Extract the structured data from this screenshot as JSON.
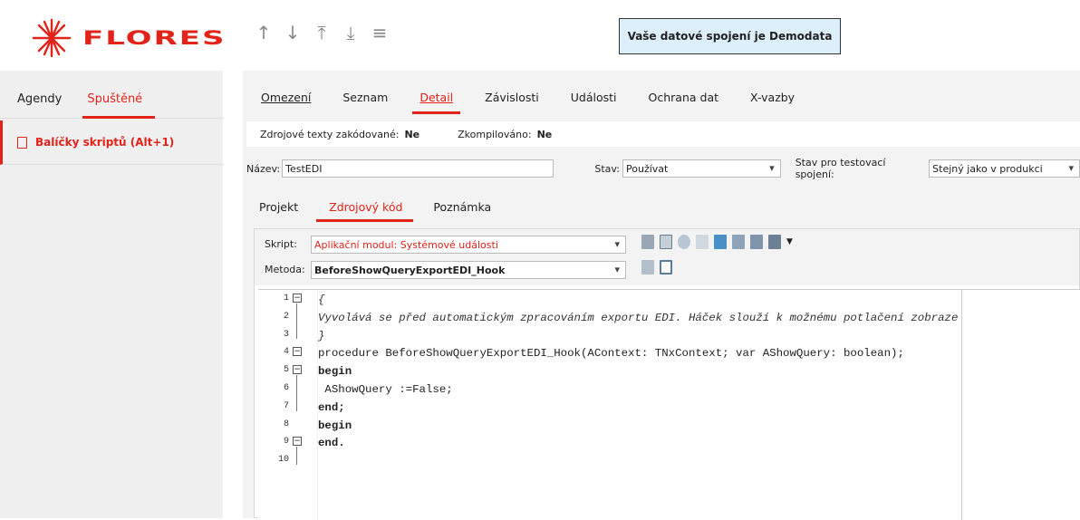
{
  "header": {
    "logo_text": "FLORES",
    "nav": [
      "↑",
      "↓",
      "⤒",
      "⤓",
      "≡"
    ],
    "connection_text": "Vaše datové spojení je Demodata",
    "brand_color": "#e2231a"
  },
  "left_panel": {
    "tabs": [
      {
        "label": "Agendy"
      },
      {
        "label": "Spuštěné"
      }
    ],
    "items": [
      {
        "label": "Balíčky skriptů (Alt+1)",
        "icon": "document-icon"
      }
    ]
  },
  "main_tabs": [
    {
      "label": "Omezení"
    },
    {
      "label": "Seznam"
    },
    {
      "label": "Detail"
    },
    {
      "label": "Závislosti"
    },
    {
      "label": "Události"
    },
    {
      "label": "Ochrana dat"
    },
    {
      "label": "X-vazby"
    }
  ],
  "info": {
    "encoded_label": "Zdrojové texty zakódované:",
    "encoded_value": "Ne",
    "compiled_label": "Zkompilováno:",
    "compiled_value": "Ne"
  },
  "fields": {
    "name_label": "Název:",
    "name_value": "TestEDI",
    "state_label": "Stav:",
    "state_value": "Používat",
    "test_state_label": "Stav pro testovací spojení:",
    "test_state_value": "Stejný jako v produkci"
  },
  "sub_tabs": [
    {
      "label": "Projekt"
    },
    {
      "label": "Zdrojový kód"
    },
    {
      "label": "Poznámka"
    }
  ],
  "script": {
    "script_label": "Skript:",
    "script_value": "Aplikační modul: Systémové události",
    "method_label": "Metoda:",
    "method_value": "BeforeShowQueryExportEDI_Hook"
  },
  "code_lines": [
    {
      "n": "1",
      "t": "{"
    },
    {
      "n": "2",
      "t": "Vyvolává se před automatickým zpracováním exportu EDI. Háček slouží k možnému potlačení zobraze"
    },
    {
      "n": "3",
      "t": "}"
    },
    {
      "n": "4",
      "t": "procedure BeforeShowQueryExportEDI_Hook(AContext: TNxContext; var AShowQuery: boolean);"
    },
    {
      "n": "5",
      "t": "begin"
    },
    {
      "n": "6",
      "t": " AShowQuery :=False;"
    },
    {
      "n": "7",
      "t": "end;"
    },
    {
      "n": "8",
      "t": ""
    },
    {
      "n": "9",
      "t": "begin"
    },
    {
      "n": "10",
      "t": "end."
    }
  ]
}
